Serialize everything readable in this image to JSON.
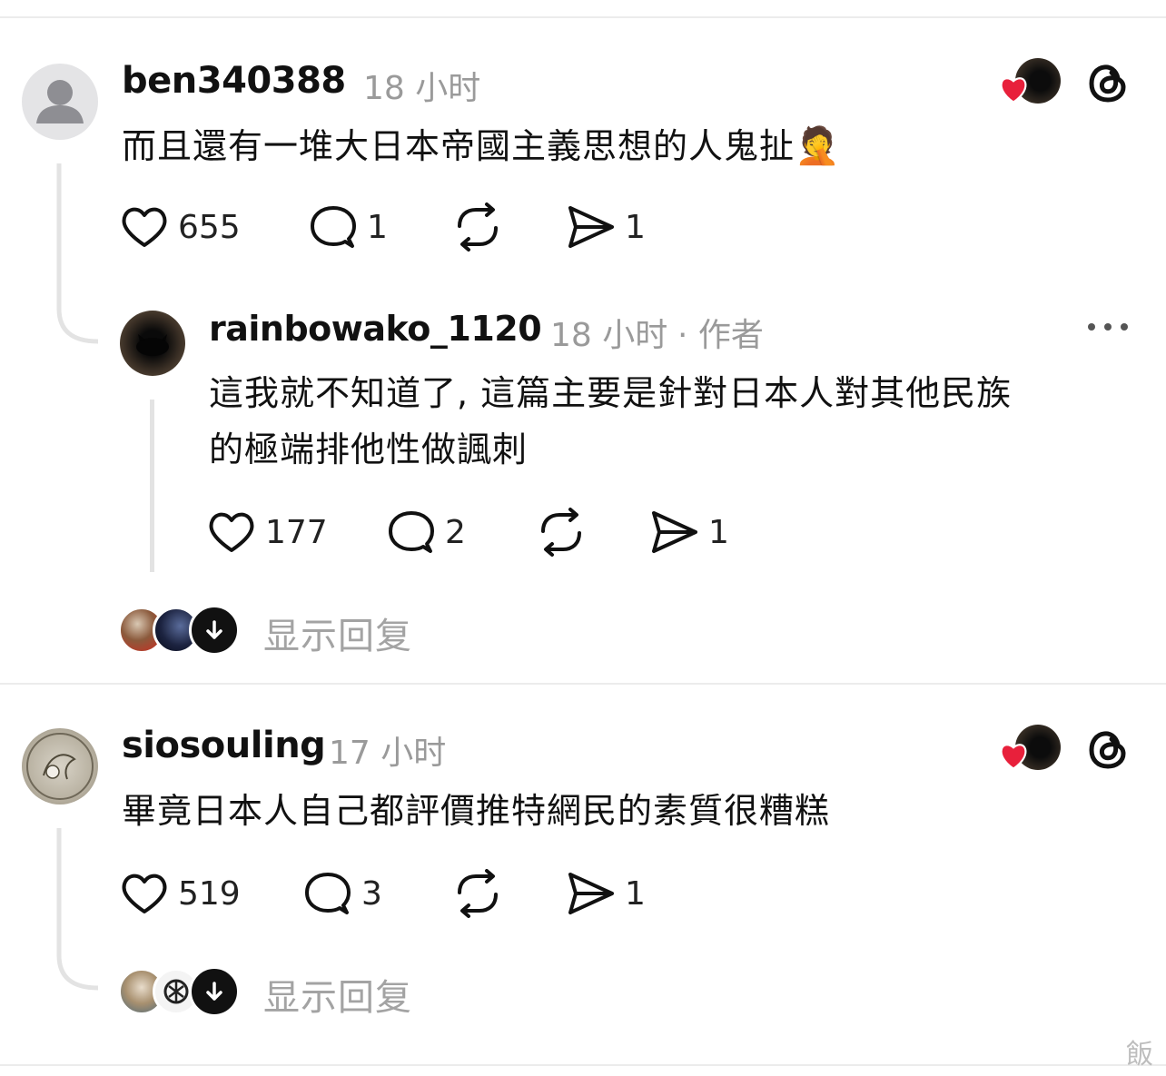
{
  "comments": [
    {
      "username": "ben340388",
      "time": "18 小时",
      "text": "而且還有一堆大日本帝國主義思想的人鬼扯",
      "emoji": "🤦",
      "likes": "655",
      "replies": "1",
      "shares": "1",
      "reply": {
        "username": "rainbowako_1120",
        "time": "18 小时",
        "badge": "· 作者",
        "text_line1": "這我就不知道了, 這篇主要是針對日本人對其他民族",
        "text_line2": "的極端排他性做諷刺",
        "likes": "177",
        "replies": "2",
        "shares": "1"
      },
      "show_replies": "显示回复"
    },
    {
      "username": "siosouling",
      "time": "17 小时",
      "text": "畢竟日本人自己都評價推特網民的素質很糟糕",
      "likes": "519",
      "replies": "3",
      "shares": "1",
      "show_replies": "显示回复"
    }
  ],
  "watermark": "飯",
  "colors": {
    "like_heart": "#e8203b",
    "muted": "#9a9a9a",
    "thread_line": "#e3e3e3"
  },
  "icons": [
    "heart-icon",
    "comment-icon",
    "repost-icon",
    "share-icon",
    "threads-icon",
    "more-icon",
    "down-arrow-icon"
  ]
}
